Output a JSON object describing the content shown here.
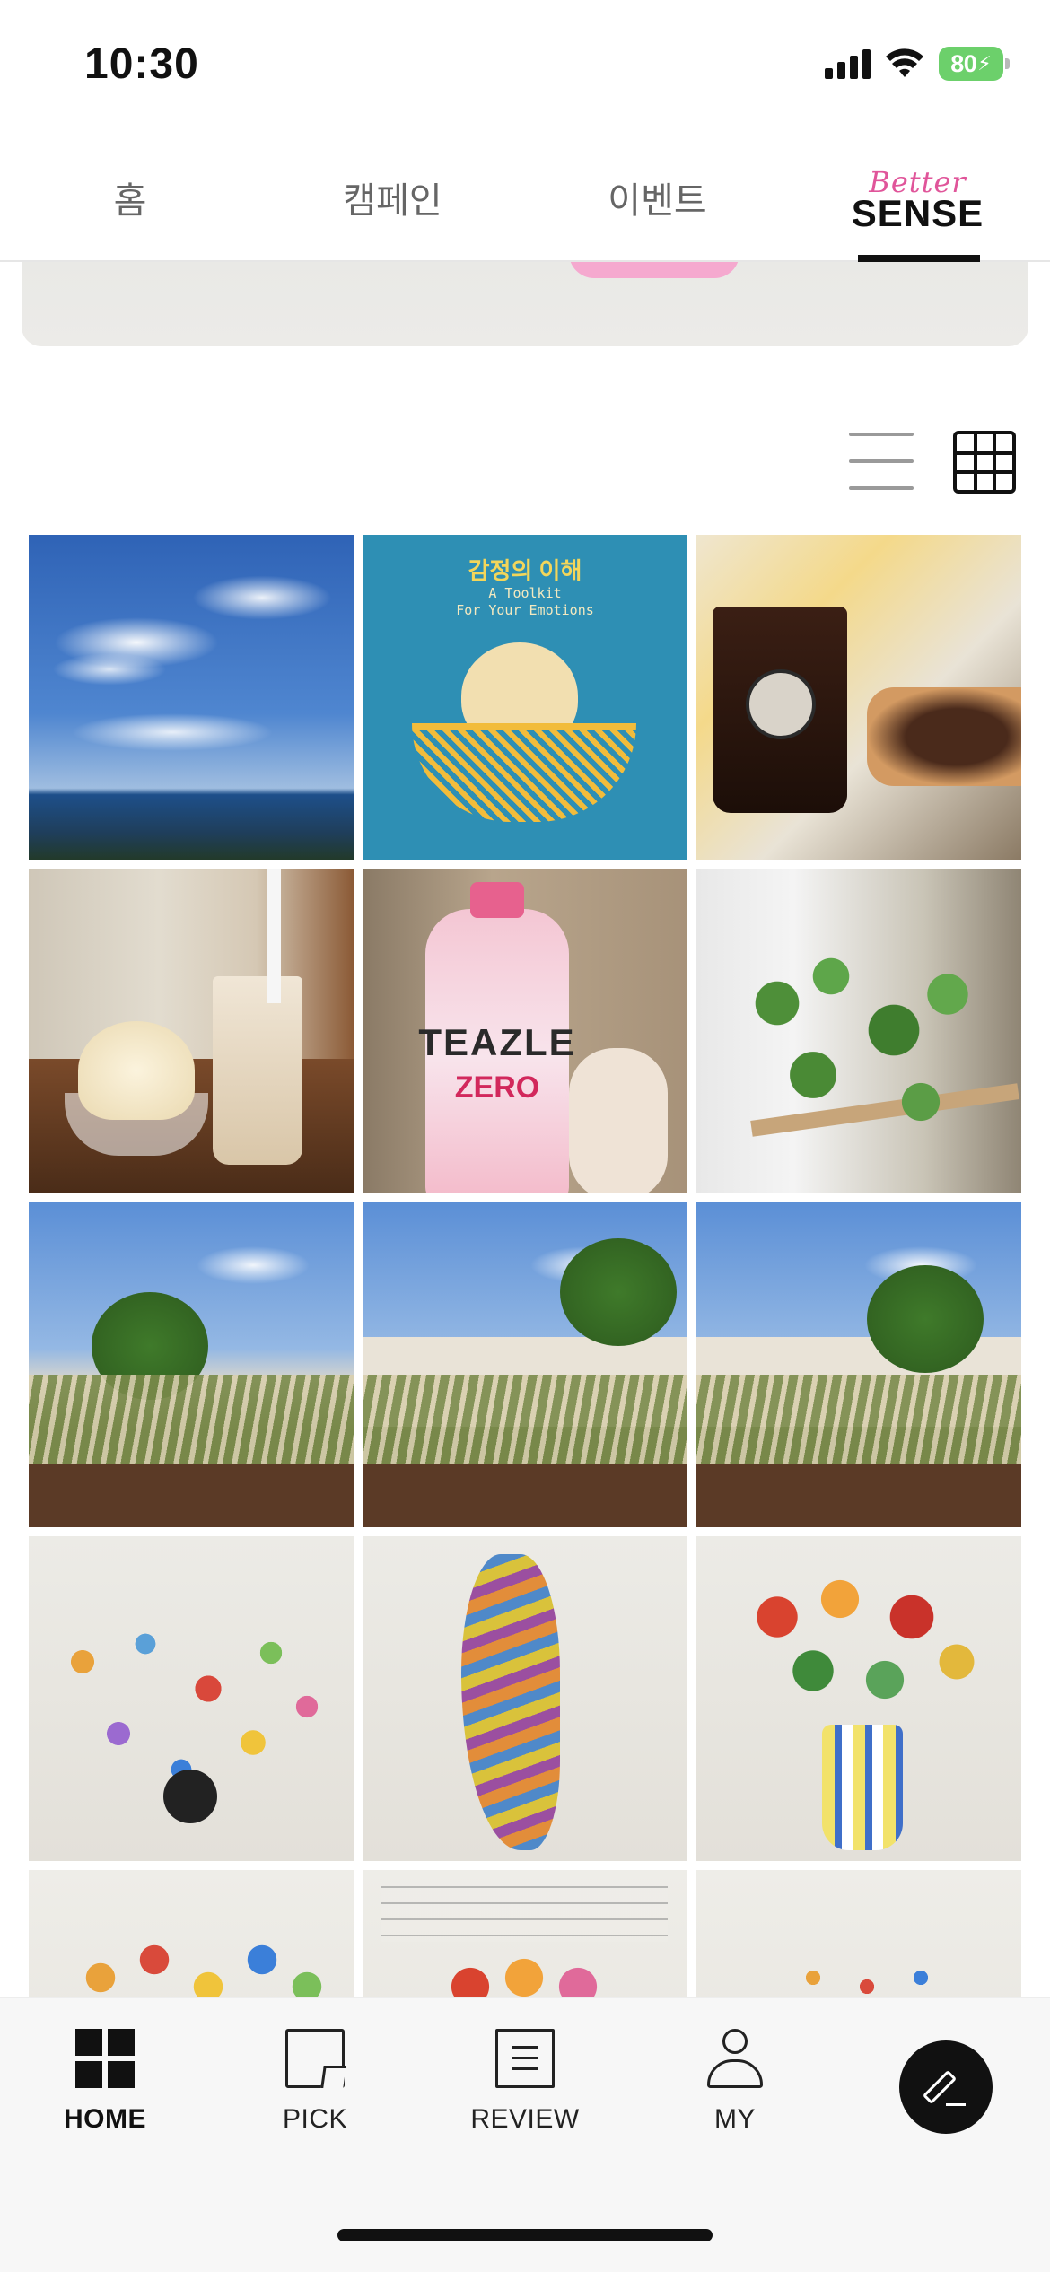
{
  "status_bar": {
    "time": "10:30",
    "battery_percent": "80",
    "battery_color": "#6cd06b",
    "icons": [
      "signal-icon",
      "wifi-icon",
      "battery-charging-icon"
    ]
  },
  "top_tabs": {
    "items": [
      {
        "label": "홈"
      },
      {
        "label": "캠페인"
      },
      {
        "label": "이벤트"
      },
      {
        "label_script": "Better",
        "label_main": "SENSE"
      }
    ],
    "active_index": 3,
    "accent_color": "#e0559a"
  },
  "view_toggle": {
    "list_icon": "list-view-icon",
    "grid_icon": "grid-view-icon",
    "active": "grid"
  },
  "photo_grid": {
    "columns": 3,
    "photos": [
      {
        "subject": "sky-over-coast"
      },
      {
        "subject": "book-cover",
        "title": "감정의 이해",
        "subtitle_line1": "A Toolkit",
        "subtitle_line2": "For Your Emotions"
      },
      {
        "subject": "iced-coffee-and-cake"
      },
      {
        "subject": "soft-serve-and-milk-tea"
      },
      {
        "subject": "teazle-bottle",
        "brand": "TEAZLE",
        "variant": "ZERO"
      },
      {
        "subject": "potted-plant"
      },
      {
        "subject": "garden-with-trees"
      },
      {
        "subject": "rooftop-garden"
      },
      {
        "subject": "rooftop-garden-2"
      },
      {
        "subject": "butterfly-artwork"
      },
      {
        "subject": "butterfly-figure-artwork"
      },
      {
        "subject": "tulip-vase-artwork"
      },
      {
        "subject": "flower-artwork-partial"
      },
      {
        "subject": "gallery-text-and-flowers"
      },
      {
        "subject": "gallery-wall-partial"
      }
    ]
  },
  "bottom_nav": {
    "items": [
      {
        "label": "HOME",
        "icon": "home-grid-icon",
        "active": true
      },
      {
        "label": "PICK",
        "icon": "bookmark-note-icon",
        "active": false
      },
      {
        "label": "REVIEW",
        "icon": "document-icon",
        "active": false
      },
      {
        "label": "MY",
        "icon": "person-icon",
        "active": false
      }
    ],
    "fab_icon": "edit-pencil-icon"
  }
}
